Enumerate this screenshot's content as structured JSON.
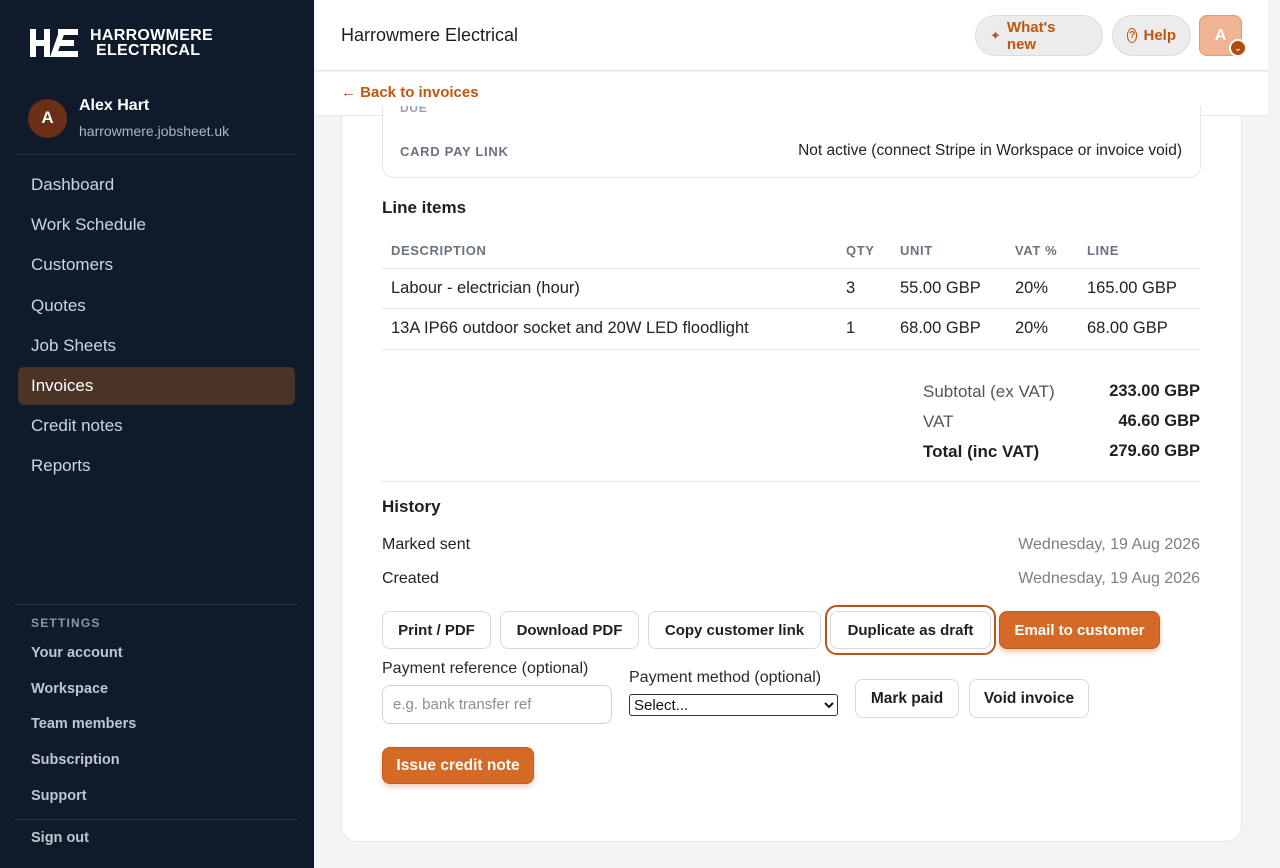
{
  "brand": {
    "line1": "HARROWMERE",
    "line2": "ELECTRICAL",
    "accent": "#c2560e"
  },
  "user": {
    "initial": "A",
    "name": "Alex Hart",
    "domain": "harrowmere.jobsheet.uk"
  },
  "nav": [
    {
      "label": "Dashboard"
    },
    {
      "label": "Work Schedule"
    },
    {
      "label": "Customers"
    },
    {
      "label": "Quotes"
    },
    {
      "label": "Job Sheets"
    },
    {
      "label": "Invoices"
    },
    {
      "label": "Credit notes"
    },
    {
      "label": "Reports"
    }
  ],
  "active_nav": "Invoices",
  "settings": {
    "heading": "SETTINGS",
    "items": [
      "Your account",
      "Workspace",
      "Team members",
      "Subscription",
      "Support"
    ],
    "sign_out": "Sign out"
  },
  "header": {
    "title": "Harrowmere Electrical",
    "whats_new": "What's new",
    "help": "Help",
    "avatar_initial": "A"
  },
  "back_link": "← Back to invoices",
  "details": {
    "due_label": "DUE",
    "card_pay_label": "CARD PAY LINK",
    "card_pay_value": "Not active (connect Stripe in Workspace or invoice void)"
  },
  "line_items": {
    "title": "Line items",
    "headers": [
      "DESCRIPTION",
      "QTY",
      "UNIT",
      "VAT %",
      "LINE"
    ],
    "rows": [
      [
        "Labour - electrician (hour)",
        "3",
        "55.00 GBP",
        "20%",
        "165.00 GBP"
      ],
      [
        "13A IP66 outdoor socket and 20W LED floodlight",
        "1",
        "68.00 GBP",
        "20%",
        "68.00 GBP"
      ]
    ]
  },
  "totals": {
    "subtotal_label": "Subtotal (ex VAT)",
    "subtotal_value": "233.00 GBP",
    "vat_label": "VAT",
    "vat_value": "46.60 GBP",
    "total_label": "Total (inc VAT)",
    "total_value": "279.60 GBP"
  },
  "history": {
    "title": "History",
    "events": [
      {
        "label": "Marked sent",
        "date": "Wednesday, 19 Aug 2026"
      },
      {
        "label": "Created",
        "date": "Wednesday, 19 Aug 2026"
      }
    ]
  },
  "actions": {
    "print": "Print / PDF",
    "download": "Download PDF",
    "copy_link": "Copy customer link",
    "duplicate": "Duplicate as draft",
    "email": "Email to customer"
  },
  "payment": {
    "ref_label": "Payment reference (optional)",
    "ref_placeholder": "e.g. bank transfer ref",
    "method_label": "Payment method (optional)",
    "method_selected": "Select...",
    "mark_paid": "Mark paid",
    "void": "Void invoice"
  },
  "credit_note_button": "Issue credit note"
}
